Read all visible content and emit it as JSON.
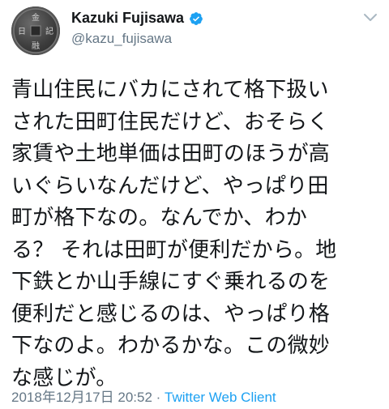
{
  "user": {
    "display_name": "Kazuki Fujisawa",
    "handle": "@kazu_fujisawa",
    "verified": true,
    "avatar_icon": "coin-avatar-icon"
  },
  "tweet": {
    "lines": [
      "青山住民にバカにされて格下扱い",
      "された田町住民だけど、おそらく",
      "家賃や土地単価は田町のほうが高",
      "いぐらいなんだけど、やっぱり田",
      "町が格下なの。なんでか、わか",
      "る？ それは田町が便利だから。地",
      "下鉄とか山手線にすぐ乗れるのを",
      "便利だと感じるのは、やっぱり格",
      "下なのよ。わかるかな。この微妙",
      "な感じが。"
    ]
  },
  "meta": {
    "timestamp": "2018年12月17日 20:52",
    "separator": " · ",
    "source": "Twitter Web Client"
  },
  "colors": {
    "verified": "#1da1f2",
    "link": "#1da1f2",
    "muted": "#657786",
    "text": "#14171a"
  }
}
